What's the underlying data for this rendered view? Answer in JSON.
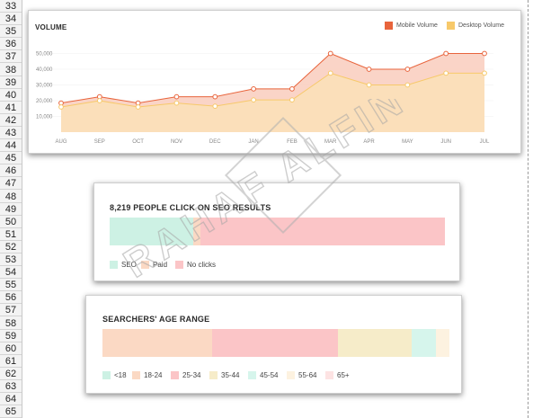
{
  "row_numbers": [
    "33",
    "34",
    "35",
    "36",
    "37",
    "38",
    "39",
    "40",
    "41",
    "42",
    "43",
    "44",
    "45",
    "46",
    "47",
    "48",
    "49",
    "50",
    "51",
    "52",
    "53",
    "54",
    "55",
    "56",
    "57",
    "58",
    "59",
    "60",
    "61",
    "62",
    "63",
    "64",
    "65"
  ],
  "volume_card": {
    "title": "VOLUME",
    "legend": [
      {
        "label": "Mobile Volume",
        "color": "#e8643c"
      },
      {
        "label": "Desktop Volume",
        "color": "#f7c96a"
      }
    ]
  },
  "chart_data": {
    "type": "area",
    "title": "VOLUME",
    "categories": [
      "AUG",
      "SEP",
      "OCT",
      "NOV",
      "DEC",
      "JAN",
      "FEB",
      "MAR",
      "APR",
      "MAY",
      "JUN",
      "JUL"
    ],
    "y_ticks": [
      "50,000",
      "40,000",
      "30,000",
      "20,000",
      "10,000"
    ],
    "ylim": [
      0,
      60000
    ],
    "series": [
      {
        "name": "Mobile Volume",
        "color": "#e8643c",
        "fill": "#f9cdbd",
        "values": [
          18500,
          22500,
          18500,
          22500,
          22500,
          27500,
          27500,
          50000,
          40000,
          40000,
          50000,
          50000
        ]
      },
      {
        "name": "Desktop Volume",
        "color": "#f7c96a",
        "fill": "#fbe0b8",
        "values": [
          16000,
          20000,
          16000,
          18500,
          16500,
          20500,
          20500,
          37500,
          30000,
          30000,
          37500,
          37500
        ]
      }
    ],
    "grid": true
  },
  "seo_card": {
    "title": "8,219 PEOPLE CLICK ON SEO RESULTS",
    "segments": [
      {
        "label": "SEO",
        "value": 0.25,
        "color": "#cdf1e4"
      },
      {
        "label": "Paid",
        "value": 0.02,
        "color": "#fbd9c4"
      },
      {
        "label": "No clicks",
        "value": 0.73,
        "color": "#fbc5c7"
      }
    ]
  },
  "age_card": {
    "title": "SEARCHERS' AGE RANGE",
    "segments": [
      {
        "label": "<18",
        "value": 0.0,
        "color": "#cdf1e4"
      },
      {
        "label": "18-24",
        "value": 0.315,
        "color": "#fbd9c4"
      },
      {
        "label": "25-34",
        "value": 0.365,
        "color": "#fbc5c7"
      },
      {
        "label": "35-44",
        "value": 0.21,
        "color": "#f6ecc9"
      },
      {
        "label": "45-54",
        "value": 0.07,
        "color": "#d6f5ec"
      },
      {
        "label": "55-64",
        "value": 0.04,
        "color": "#fdf2e0"
      },
      {
        "label": "65+",
        "value": 0.0,
        "color": "#fde3e3"
      }
    ]
  },
  "watermark_text": "RAHAF ALFIN"
}
